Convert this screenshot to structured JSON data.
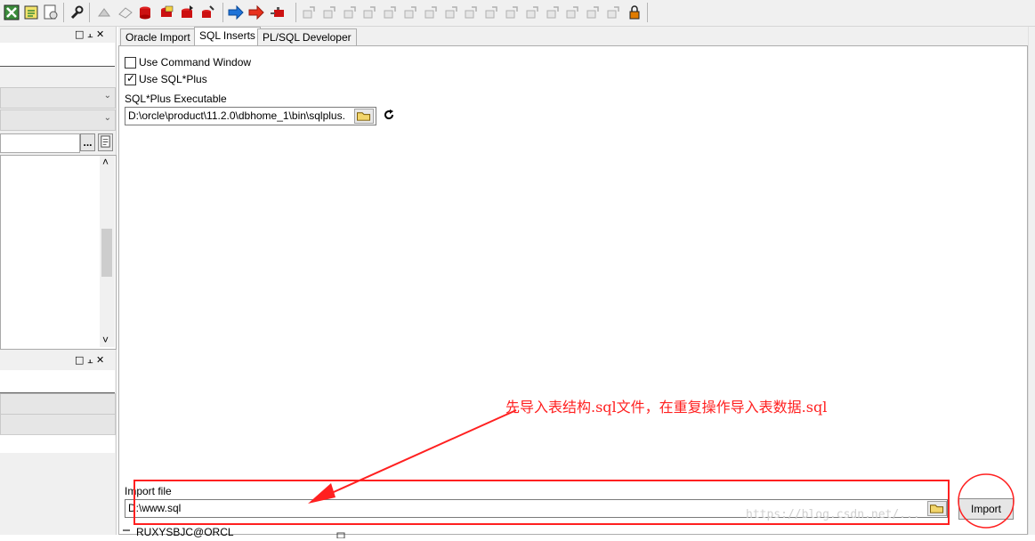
{
  "toolbar": {
    "icons": [
      "wizard-icon",
      "edit-icon",
      "report-icon",
      "wrench-icon",
      "compile-icon",
      "eraser-icon",
      "db-red-icon",
      "db-yellow-icon",
      "db-arrow-icon",
      "db-brush-icon",
      "arrow-right-blue-icon",
      "arrow-right-red-icon",
      "plug-red-icon",
      "disabled-tool-icon",
      "lock-tool-icon"
    ]
  },
  "left_dock": {
    "top_controls": "□ ⫠ ✕",
    "bottom_controls": "□ ⫠ ✕",
    "browse_button": "...",
    "scroll_up": "˄",
    "scroll_down": "˅"
  },
  "tabs": [
    "Oracle Import",
    "SQL Inserts",
    "PL/SQL Developer"
  ],
  "active_tab": "SQL Inserts",
  "options": {
    "use_command_window": {
      "label": "Use Command Window",
      "checked": false
    },
    "use_sqlplus": {
      "label": "Use SQL*Plus",
      "checked": true
    },
    "executable_label": "SQL*Plus Executable",
    "executable_value": "D:\\orcle\\product\\11.2.0\\dbhome_1\\bin\\sqlplus."
  },
  "import": {
    "file_label": "Import file",
    "file_value": "D:\\www.sql",
    "button_label": "Import"
  },
  "annotation": {
    "text": "先导入表结构.sql文件，在重复操作导入表数据.sql",
    "color": "#ff2020"
  },
  "status": {
    "connection": "RUXYSBJC@ORCL"
  },
  "watermark": "https://blog.csdn.net/..."
}
